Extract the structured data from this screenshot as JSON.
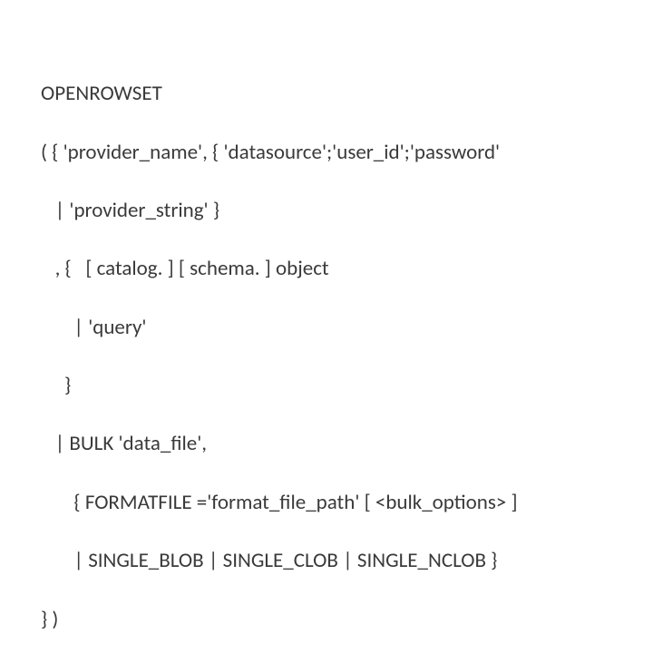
{
  "syntax": {
    "lines": [
      "OPENROWSET",
      "( { 'provider_name', { 'datasource';'user_id';'password'",
      "   | 'provider_string' }",
      "   , {   [ catalog. ] [ schema. ] object",
      "       | 'query'",
      "     }",
      "   | BULK 'data_file',",
      "       { FORMATFILE ='format_file_path' [ <bulk_options> ]",
      "       | SINGLE_BLOB | SINGLE_CLOB | SINGLE_NCLOB }",
      "} )"
    ]
  }
}
